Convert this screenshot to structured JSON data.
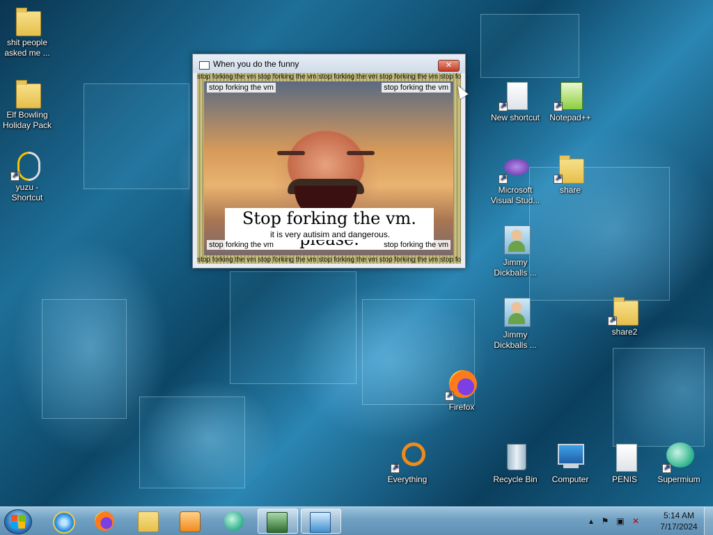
{
  "desktop": {
    "icons": [
      {
        "label": "shit people asked me ...",
        "type": "folder"
      },
      {
        "label": "Elf Bowling Holiday Pack",
        "type": "folder"
      },
      {
        "label": "yuzu - Shortcut",
        "type": "app"
      },
      {
        "label": "New shortcut",
        "type": "document"
      },
      {
        "label": "Notepad++",
        "type": "app"
      },
      {
        "label": "Microsoft Visual Stud...",
        "type": "app"
      },
      {
        "label": "share",
        "type": "folder"
      },
      {
        "label": "Jimmy Dickballs ...",
        "type": "contact"
      },
      {
        "label": "Jimmy Dickballs ...",
        "type": "contact"
      },
      {
        "label": "share2",
        "type": "folder"
      },
      {
        "label": "Firefox",
        "type": "app"
      },
      {
        "label": "Everything",
        "type": "app"
      },
      {
        "label": "Recycle Bin",
        "type": "system"
      },
      {
        "label": "Computer",
        "type": "system"
      },
      {
        "label": "PENIS",
        "type": "document"
      },
      {
        "label": "Supermium",
        "type": "app"
      }
    ]
  },
  "popup": {
    "title": "When you do the funny",
    "close_label": "✕",
    "ticker_text": "stop forking the vm stop forking the vm stop forking the vm stop forking the vm stop forking the vm stop forking the vm stop forking the vm",
    "corner_text": "stop forking the vm",
    "meme_title": "Stop forking the vm. please.",
    "meme_subtitle": "it is very autisim and dangerous."
  },
  "taskbar": {
    "pinned": [
      {
        "name": "internet-explorer-icon",
        "color": "#2a8fe0"
      },
      {
        "name": "firefox-icon",
        "color": "#ff7a1a"
      },
      {
        "name": "file-explorer-icon",
        "color": "#f2c84b"
      },
      {
        "name": "media-player-icon",
        "color": "#f08a1c"
      },
      {
        "name": "supermium-icon",
        "color": "#2bb38a"
      },
      {
        "name": "terminal-icon",
        "color": "#2d6a2d"
      },
      {
        "name": "control-panel-icon",
        "color": "#3f8ed0"
      }
    ],
    "tray": {
      "time": "5:14 AM",
      "date": "7/17/2024"
    }
  }
}
